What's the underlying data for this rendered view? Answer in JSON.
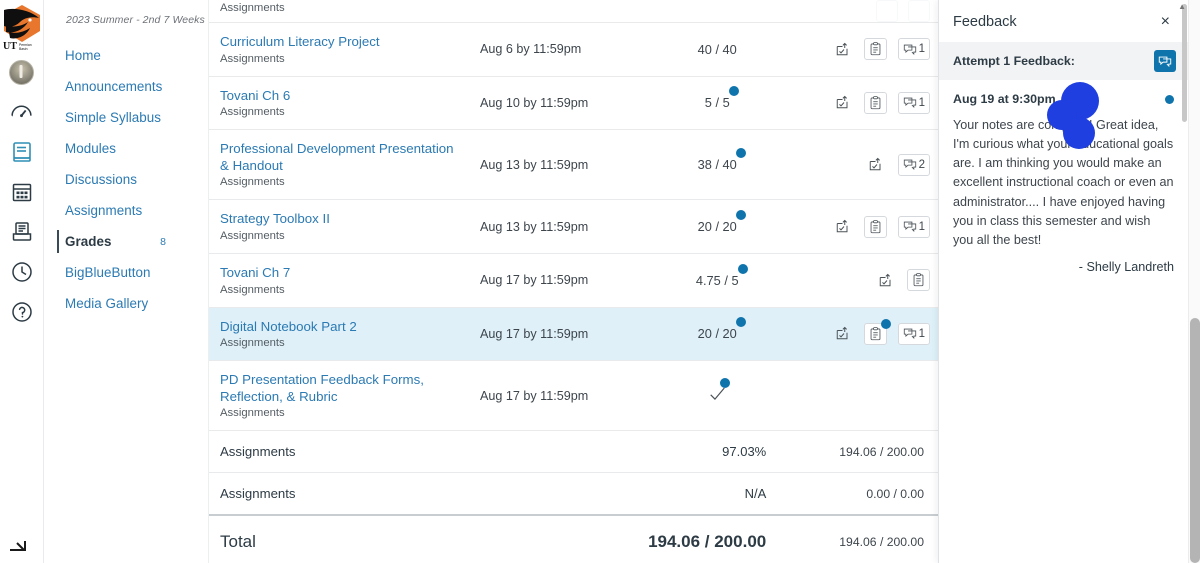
{
  "global_nav": {
    "logo_alt": "UT Permian Basin",
    "items": [
      {
        "name": "account-avatar",
        "label": "Account"
      },
      {
        "name": "dashboard-icon",
        "label": "Dashboard"
      },
      {
        "name": "courses-icon",
        "label": "Courses"
      },
      {
        "name": "calendar-icon",
        "label": "Calendar"
      },
      {
        "name": "inbox-icon",
        "label": "Inbox"
      },
      {
        "name": "history-icon",
        "label": "History"
      },
      {
        "name": "help-icon",
        "label": "Help"
      }
    ],
    "collapse_label": "Minimize Global Navigation"
  },
  "course_nav": {
    "term": "2023 Summer - 2nd 7 Weeks",
    "items": [
      {
        "label": "Home",
        "active": false,
        "badge": ""
      },
      {
        "label": "Announcements",
        "active": false,
        "badge": ""
      },
      {
        "label": "Simple Syllabus",
        "active": false,
        "badge": ""
      },
      {
        "label": "Modules",
        "active": false,
        "badge": ""
      },
      {
        "label": "Discussions",
        "active": false,
        "badge": ""
      },
      {
        "label": "Assignments",
        "active": false,
        "badge": ""
      },
      {
        "label": "Grades",
        "active": true,
        "badge": "8"
      },
      {
        "label": "BigBlueButton",
        "active": false,
        "badge": ""
      },
      {
        "label": "Media Gallery",
        "active": false,
        "badge": ""
      }
    ]
  },
  "grades": {
    "partial_top_row": {
      "context": "Assignments"
    },
    "rows": [
      {
        "name": "Curriculum Literacy Project",
        "context": "Assignments",
        "due": "Aug 6 by 11:59pm",
        "score": "40 / 40",
        "score_new": false,
        "highlight": false,
        "icons": [
          {
            "name": "submission-upload-icon",
            "type": "plain",
            "count": "",
            "new": false
          },
          {
            "name": "rubric-icon",
            "type": "boxed",
            "count": "",
            "new": false
          },
          {
            "name": "comment-icon",
            "type": "boxed",
            "count": "1",
            "new": false
          }
        ]
      },
      {
        "name": "Tovani Ch 6",
        "context": "Assignments",
        "due": "Aug 10 by 11:59pm",
        "score": "5 / 5",
        "score_new": true,
        "highlight": false,
        "icons": [
          {
            "name": "submission-upload-icon",
            "type": "plain",
            "count": "",
            "new": false
          },
          {
            "name": "rubric-icon",
            "type": "boxed",
            "count": "",
            "new": false
          },
          {
            "name": "comment-icon",
            "type": "boxed",
            "count": "1",
            "new": false
          }
        ]
      },
      {
        "name": "Professional Development Presentation & Handout",
        "context": "Assignments",
        "due": "Aug 13 by 11:59pm",
        "score": "38 / 40",
        "score_new": true,
        "highlight": false,
        "icons": [
          {
            "name": "submission-upload-icon",
            "type": "plain",
            "count": "",
            "new": false
          },
          {
            "name": "comment-icon",
            "type": "boxed",
            "count": "2",
            "new": false
          }
        ]
      },
      {
        "name": "Strategy Toolbox II",
        "context": "Assignments",
        "due": "Aug 13 by 11:59pm",
        "score": "20 / 20",
        "score_new": true,
        "highlight": false,
        "icons": [
          {
            "name": "submission-upload-icon",
            "type": "plain",
            "count": "",
            "new": false
          },
          {
            "name": "rubric-icon",
            "type": "boxed",
            "count": "",
            "new": false
          },
          {
            "name": "comment-icon",
            "type": "boxed",
            "count": "1",
            "new": false
          }
        ]
      },
      {
        "name": "Tovani Ch 7",
        "context": "Assignments",
        "due": "Aug 17 by 11:59pm",
        "score": "4.75 / 5",
        "score_new": true,
        "highlight": false,
        "icons": [
          {
            "name": "submission-upload-icon",
            "type": "plain",
            "count": "",
            "new": false
          },
          {
            "name": "rubric-icon",
            "type": "boxed",
            "count": "",
            "new": false
          }
        ]
      },
      {
        "name": "Digital Notebook Part 2",
        "context": "Assignments",
        "due": "Aug 17 by 11:59pm",
        "score": "20 / 20",
        "score_new": true,
        "highlight": true,
        "icons": [
          {
            "name": "submission-upload-icon",
            "type": "plain",
            "count": "",
            "new": false
          },
          {
            "name": "rubric-icon",
            "type": "boxed",
            "count": "",
            "new": true
          },
          {
            "name": "comment-icon",
            "type": "boxed",
            "count": "1",
            "new": false
          }
        ]
      },
      {
        "name": "PD Presentation Feedback Forms, Reflection, & Rubric",
        "context": "Assignments",
        "due": "Aug 17 by 11:59pm",
        "score": "",
        "score_icon": "check-icon",
        "score_new": true,
        "highlight": false,
        "icons": []
      }
    ],
    "group_totals": [
      {
        "label": "Assignments",
        "percent": "97.03%",
        "points": "194.06 / 200.00"
      },
      {
        "label": "Assignments",
        "percent": "N/A",
        "points": "0.00 / 0.00"
      }
    ],
    "total": {
      "label": "Total",
      "score": "194.06 / 200.00",
      "points": "194.06 / 200.00"
    }
  },
  "feedback_tray": {
    "title": "Feedback",
    "close_label": "×",
    "attempt_label": "Attempt 1 Feedback:",
    "attempt_icon": "comment-icon",
    "date": "Aug 19 at 9:30pm",
    "body": "Your notes are complete! Great idea, I'm curious what your educational goals are. I am thinking you would make an excellent instructional coach or even an administrator.... I have enjoyed having you in class this semester and wish you all the best!",
    "author": "- Shelly Landreth"
  },
  "colors": {
    "link": "#2b7ab3",
    "accent_blue": "#0f74ac",
    "highlight_row": "#dff0f8",
    "redaction": "#1f3fe0",
    "text": "#2d3b45"
  }
}
